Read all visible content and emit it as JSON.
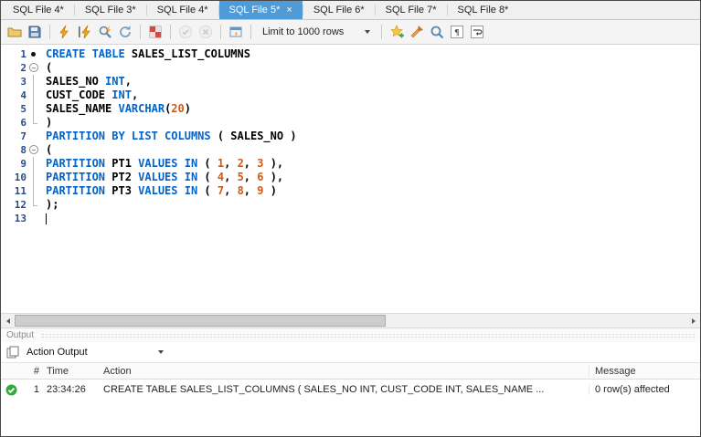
{
  "tabs": {
    "items": [
      {
        "label": "SQL File 4*"
      },
      {
        "label": "SQL File 3*"
      },
      {
        "label": "SQL File 4*"
      },
      {
        "label": "SQL File 5*"
      },
      {
        "label": "SQL File 6*"
      },
      {
        "label": "SQL File 7*"
      },
      {
        "label": "SQL File 8*"
      }
    ],
    "active_index": 3,
    "close_label": "×"
  },
  "toolbar": {
    "items": [
      {
        "type": "icon",
        "name": "open-script-icon"
      },
      {
        "type": "icon",
        "name": "save-script-icon"
      },
      {
        "type": "sep"
      },
      {
        "type": "icon",
        "name": "execute-icon"
      },
      {
        "type": "icon",
        "name": "execute-current-icon"
      },
      {
        "type": "icon",
        "name": "explain-icon"
      },
      {
        "type": "icon",
        "name": "reconnect-icon"
      },
      {
        "type": "sep"
      },
      {
        "type": "icon",
        "name": "stop-on-error-icon"
      },
      {
        "type": "sep"
      },
      {
        "type": "icon",
        "name": "commit-icon",
        "disabled": true
      },
      {
        "type": "icon",
        "name": "rollback-icon",
        "disabled": true
      },
      {
        "type": "sep"
      },
      {
        "type": "icon",
        "name": "autocommit-icon"
      },
      {
        "type": "sep"
      },
      {
        "type": "dropdown",
        "name": "limit-rows-dropdown",
        "value": "Limit to 1000 rows"
      },
      {
        "type": "sep"
      },
      {
        "type": "icon",
        "name": "save-snippet-icon"
      },
      {
        "type": "icon",
        "name": "beautify-icon"
      },
      {
        "type": "icon",
        "name": "find-icon"
      },
      {
        "type": "icon",
        "name": "invisible-characters-icon"
      },
      {
        "type": "icon",
        "name": "wrap-text-icon"
      }
    ]
  },
  "editor": {
    "lines": [
      {
        "no": "1",
        "marker": "dot",
        "tokens": [
          {
            "t": "CREATE TABLE ",
            "c": "kw"
          },
          {
            "t": "SALES_LIST_COLUMNS",
            "c": "id"
          }
        ]
      },
      {
        "no": "2",
        "marker": "fold",
        "tokens": [
          {
            "t": "(",
            "c": "id"
          }
        ]
      },
      {
        "no": "3",
        "marker": "bar",
        "tokens": [
          {
            "t": "SALES_NO ",
            "c": "id"
          },
          {
            "t": "INT",
            "c": "kw"
          },
          {
            "t": ",",
            "c": "id"
          }
        ]
      },
      {
        "no": "4",
        "marker": "bar",
        "tokens": [
          {
            "t": "CUST_CODE ",
            "c": "id"
          },
          {
            "t": "INT",
            "c": "kw"
          },
          {
            "t": ",",
            "c": "id"
          }
        ]
      },
      {
        "no": "5",
        "marker": "bar",
        "tokens": [
          {
            "t": "SALES_NAME ",
            "c": "id"
          },
          {
            "t": "VARCHAR",
            "c": "kw"
          },
          {
            "t": "(",
            "c": "id"
          },
          {
            "t": "20",
            "c": "num"
          },
          {
            "t": ")",
            "c": "id"
          }
        ]
      },
      {
        "no": "6",
        "marker": "foldend",
        "tokens": [
          {
            "t": ")",
            "c": "id"
          }
        ]
      },
      {
        "no": "7",
        "marker": "",
        "tokens": [
          {
            "t": "PARTITION BY LIST COLUMNS",
            "c": "kw"
          },
          {
            "t": " ( SALES_NO )",
            "c": "id"
          }
        ]
      },
      {
        "no": "8",
        "marker": "fold",
        "tokens": [
          {
            "t": "(",
            "c": "id"
          }
        ]
      },
      {
        "no": "9",
        "marker": "bar",
        "tokens": [
          {
            "t": "PARTITION",
            "c": "kw"
          },
          {
            "t": " PT1 ",
            "c": "id"
          },
          {
            "t": "VALUES IN",
            "c": "kw"
          },
          {
            "t": " ( ",
            "c": "id"
          },
          {
            "t": "1",
            "c": "num"
          },
          {
            "t": ", ",
            "c": "id"
          },
          {
            "t": "2",
            "c": "num"
          },
          {
            "t": ", ",
            "c": "id"
          },
          {
            "t": "3",
            "c": "num"
          },
          {
            "t": " ),",
            "c": "id"
          }
        ]
      },
      {
        "no": "10",
        "marker": "bar",
        "tokens": [
          {
            "t": "PARTITION",
            "c": "kw"
          },
          {
            "t": " PT2 ",
            "c": "id"
          },
          {
            "t": "VALUES IN",
            "c": "kw"
          },
          {
            "t": " ( ",
            "c": "id"
          },
          {
            "t": "4",
            "c": "num"
          },
          {
            "t": ", ",
            "c": "id"
          },
          {
            "t": "5",
            "c": "num"
          },
          {
            "t": ", ",
            "c": "id"
          },
          {
            "t": "6",
            "c": "num"
          },
          {
            "t": " ),",
            "c": "id"
          }
        ]
      },
      {
        "no": "11",
        "marker": "bar",
        "tokens": [
          {
            "t": "PARTITION",
            "c": "kw"
          },
          {
            "t": " PT3 ",
            "c": "id"
          },
          {
            "t": "VALUES IN",
            "c": "kw"
          },
          {
            "t": " ( ",
            "c": "id"
          },
          {
            "t": "7",
            "c": "num"
          },
          {
            "t": ", ",
            "c": "id"
          },
          {
            "t": "8",
            "c": "num"
          },
          {
            "t": ", ",
            "c": "id"
          },
          {
            "t": "9",
            "c": "num"
          },
          {
            "t": " )",
            "c": "id"
          }
        ]
      },
      {
        "no": "12",
        "marker": "foldend",
        "tokens": [
          {
            "t": ");",
            "c": "id"
          }
        ]
      },
      {
        "no": "13",
        "marker": "",
        "cursor": true,
        "tokens": []
      }
    ]
  },
  "output": {
    "title": "Output",
    "selector": "Action Output",
    "columns": [
      "#",
      "Time",
      "Action",
      "Message"
    ],
    "rows": [
      {
        "status": "success",
        "num": "1",
        "time": "23:34:26",
        "action": "CREATE TABLE SALES_LIST_COLUMNS ( SALES_NO INT, CUST_CODE INT, SALES_NAME ...",
        "message": "0 row(s) affected"
      }
    ]
  },
  "colors": {
    "active_tab": "#4f9bd8",
    "keyword": "#0463c8",
    "number_literal": "#cf5c16",
    "success_green": "#36a93c"
  }
}
